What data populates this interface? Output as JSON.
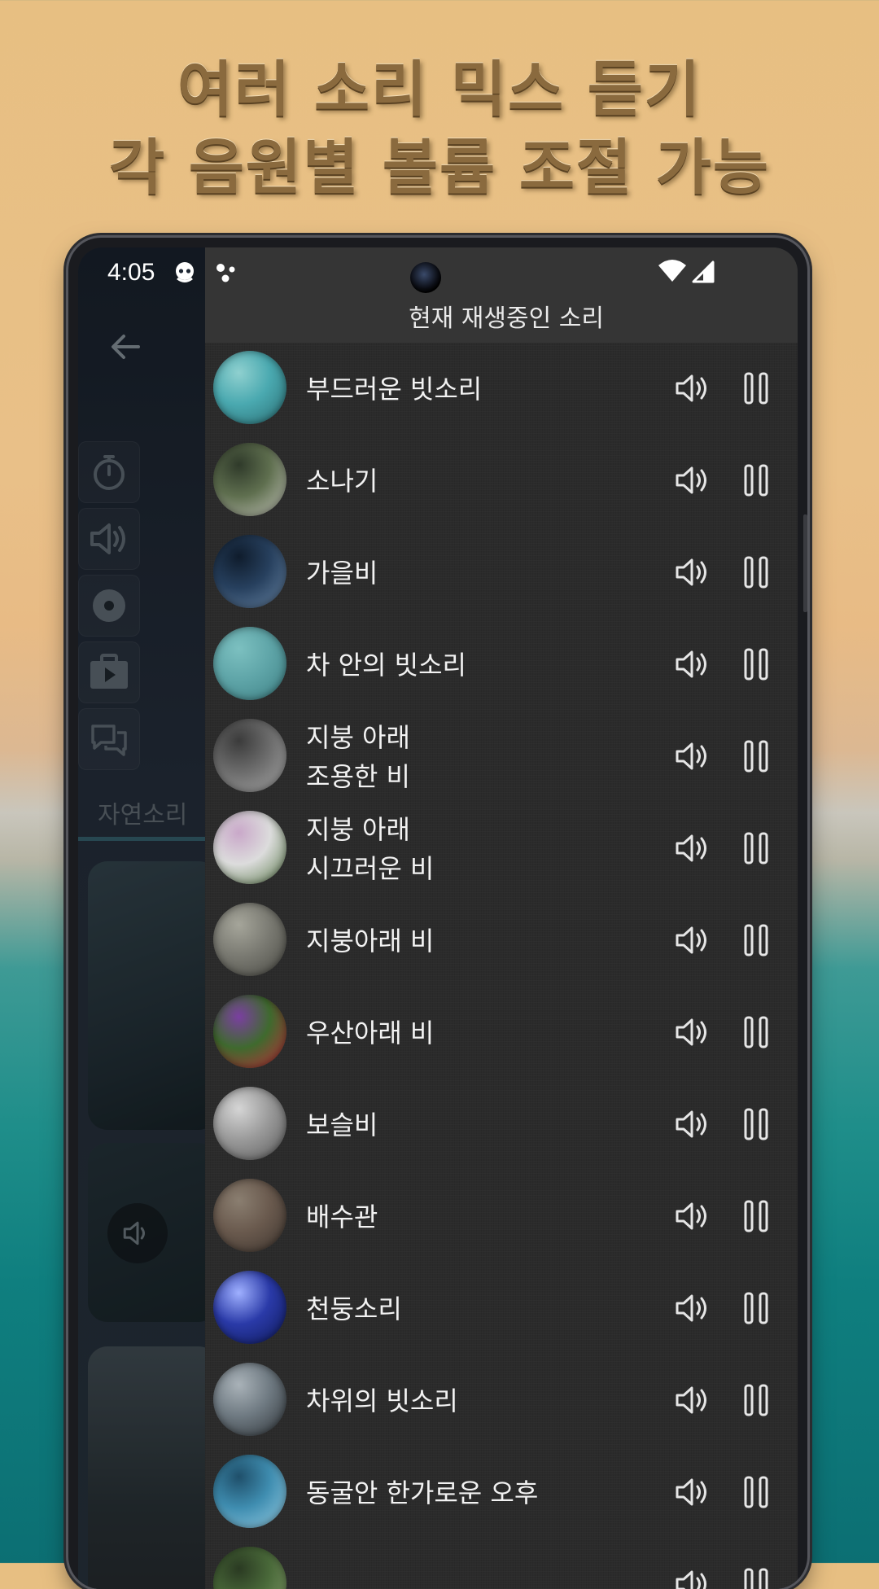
{
  "promo": {
    "line1": "여러 소리 믹스 듣기",
    "line2": "각 음원별 볼륨 조절 가능"
  },
  "status_bar": {
    "time": "4:05"
  },
  "background_app": {
    "tab_label": "자연소리"
  },
  "panel": {
    "title": "현재 재생중인 소리",
    "items": [
      {
        "line1": "부드러운 빗소리",
        "line2": "",
        "thumb": [
          "#4aa9b0",
          "#2b6e73",
          "#8fd0cf"
        ]
      },
      {
        "line1": "소나기",
        "line2": "",
        "thumb": [
          "#5f6f4f",
          "#c9c9c0",
          "#2f3a2a"
        ]
      },
      {
        "line1": "가을비",
        "line2": "",
        "thumb": [
          "#27405e",
          "#6a87a6",
          "#0f1c2c"
        ]
      },
      {
        "line1": "차 안의 빗소리",
        "line2": "",
        "thumb": [
          "#5fa5a8",
          "#3e8185",
          "#7cc0c0"
        ]
      },
      {
        "line1": "지붕 아래",
        "line2": "조용한 비",
        "thumb": [
          "#6c6c6c",
          "#a9a9a9",
          "#3b3b3b"
        ]
      },
      {
        "line1": "지붕 아래",
        "line2": "시끄러운 비",
        "thumb": [
          "#dcdcdc",
          "#5a7a4a",
          "#c9a8c9"
        ]
      },
      {
        "line1": "지붕아래 비",
        "line2": "",
        "thumb": [
          "#7a7a72",
          "#4a4a44",
          "#a5a59a"
        ]
      },
      {
        "line1": "우산아래 비",
        "line2": "",
        "thumb": [
          "#3f6a2e",
          "#c9283a",
          "#7a3fa0"
        ]
      },
      {
        "line1": "보슬비",
        "line2": "",
        "thumb": [
          "#9a9a9a",
          "#5a5a5a",
          "#d5d5d5"
        ]
      },
      {
        "line1": "배수관",
        "line2": "",
        "thumb": [
          "#6a5a4e",
          "#3e352f",
          "#8a7e70"
        ]
      },
      {
        "line1": "천둥소리",
        "line2": "",
        "thumb": [
          "#2a3aa8",
          "#0f1a5a",
          "#9fb0ff"
        ]
      },
      {
        "line1": "차위의 빗소리",
        "line2": "",
        "thumb": [
          "#6f7a82",
          "#2f3438",
          "#a9b2b8"
        ]
      },
      {
        "line1": "동굴안 한가로운 오후",
        "line2": "",
        "thumb": [
          "#3f8db0",
          "#9ad0e6",
          "#1f4f6a"
        ]
      },
      {
        "line1": "",
        "line2": "",
        "thumb": [
          "#4a6a3a",
          "#8aa070",
          "#2a3a22"
        ]
      }
    ]
  }
}
